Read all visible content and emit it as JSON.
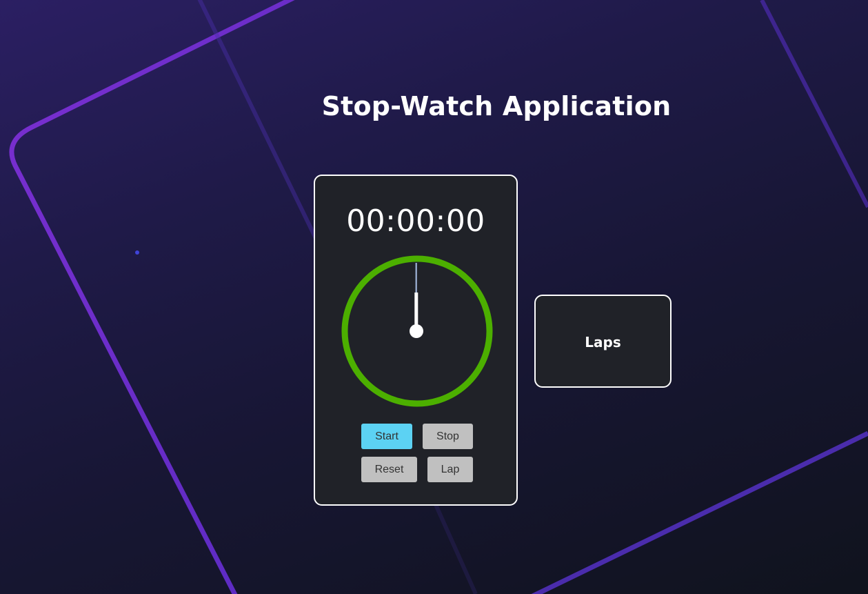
{
  "app": {
    "title": "Stop-Watch Application"
  },
  "stopwatch": {
    "time": "00:00:00",
    "dial_color": "#4caf00",
    "buttons": {
      "start": "Start",
      "stop": "Stop",
      "reset": "Reset",
      "lap": "Lap"
    },
    "start_color": "#5cd2f3"
  },
  "laps": {
    "title": "Laps"
  },
  "colors": {
    "accent_line": "#7b2fd0",
    "card_bg": "#202228"
  }
}
